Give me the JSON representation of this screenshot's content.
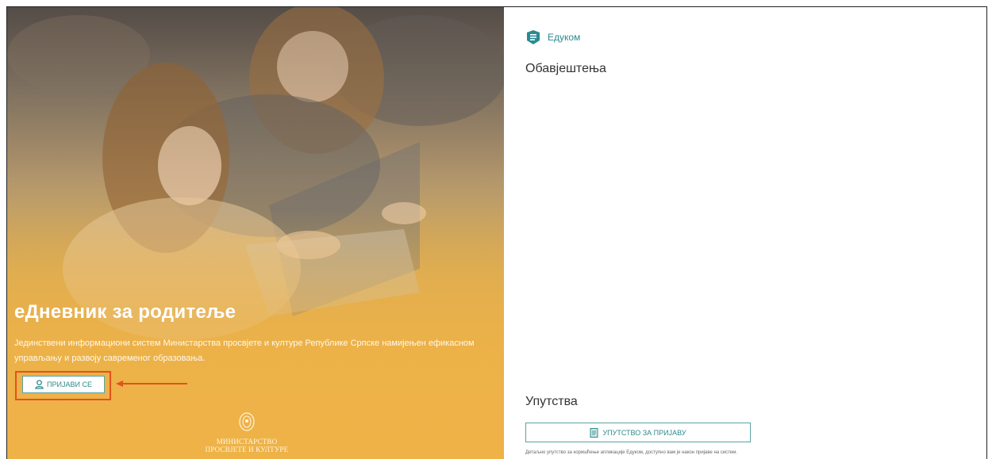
{
  "hero": {
    "title": "еДневник за родитеље",
    "description": "Јединствени информациони систем Министарства просвјете и културе Републике Српске намијењен ефикасном управљању и развоју савременог образовања.",
    "login_label": "ПРИЈАВИ СЕ",
    "ministry_line1": "МИНИСТАРСТВО",
    "ministry_line2": "ПРОСВЈЕТЕ И КУЛТУРЕ"
  },
  "brand": {
    "name": "Едуком",
    "logo_icon": "edukom-logo-icon",
    "color": "#2a8a92"
  },
  "notices": {
    "title": "Обавјештења"
  },
  "guides": {
    "title": "Упутства",
    "button_label": "УПУТСТВО ЗА ПРИЈАВУ",
    "button_icon": "document-icon",
    "note": "Детаљно упутство за коришћење апликације Едуком, доступно вам је након пријаве на систем."
  },
  "colors": {
    "accent": "#2e8b8b",
    "highlight": "#e0531f",
    "hero_overlay": "#eeb44d"
  }
}
